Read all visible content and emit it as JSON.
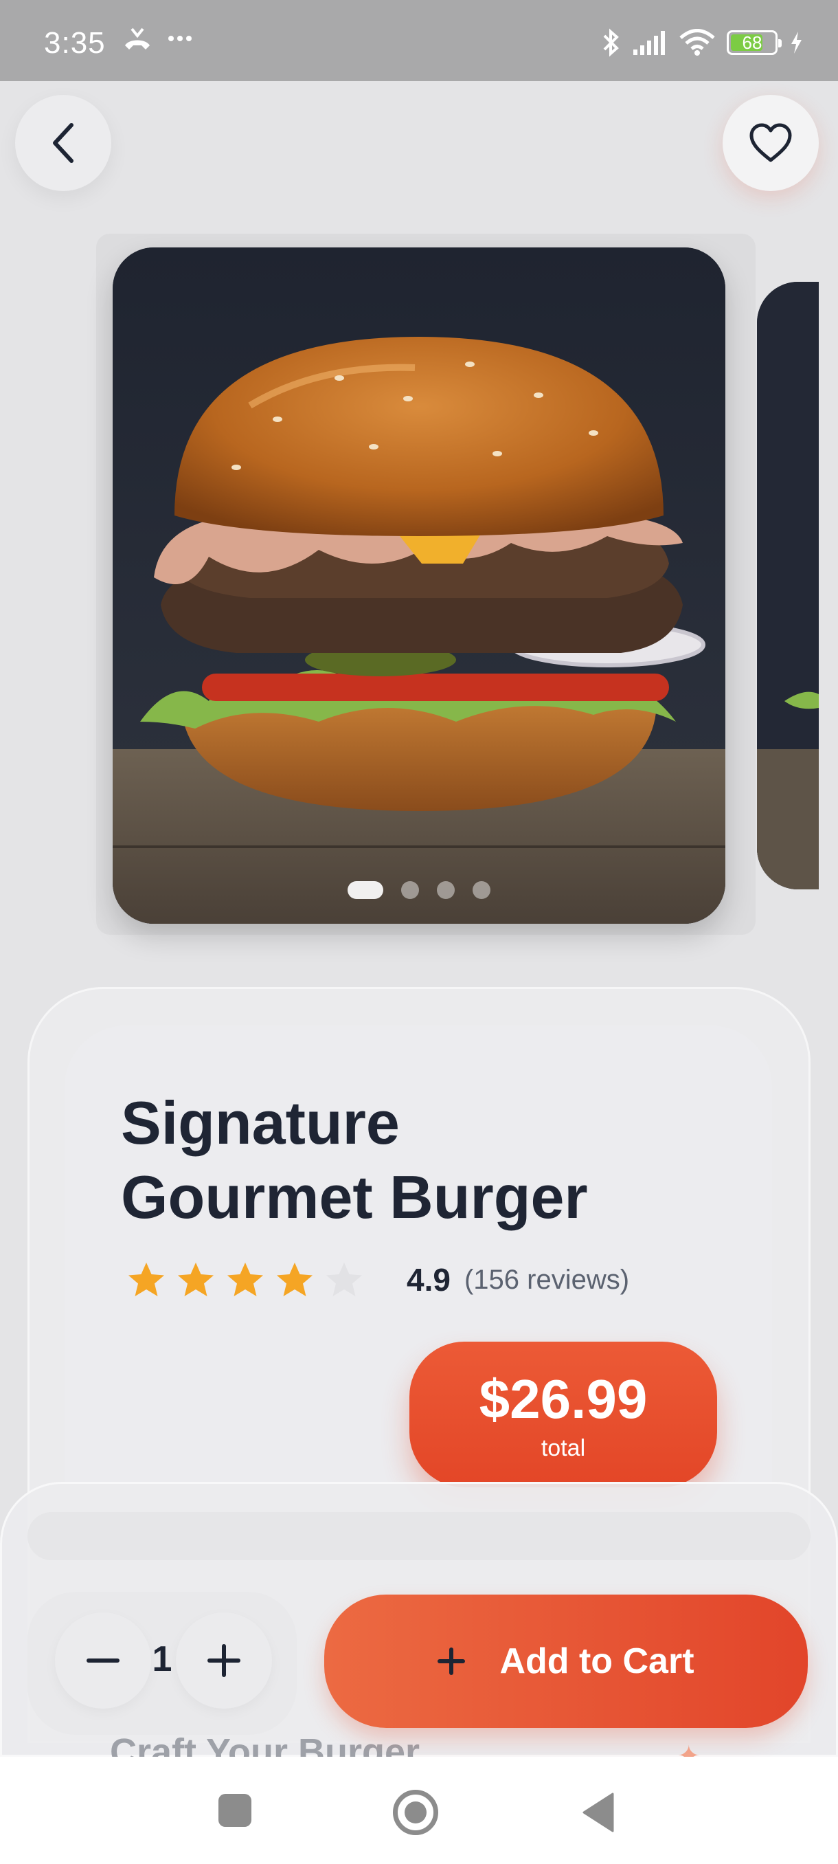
{
  "status_bar": {
    "time": "3:35",
    "battery_level": "68",
    "icons": [
      "missed-call-icon",
      "more-dots-icon",
      "bluetooth-icon",
      "signal-icon",
      "wifi-icon",
      "battery-icon",
      "charging-icon"
    ]
  },
  "header": {
    "back_icon": "chevron-left-icon",
    "favorite_icon": "heart-outline-icon"
  },
  "carousel": {
    "slide_count": 4,
    "active_index": 0
  },
  "product": {
    "title_line1": "Signature",
    "title_line2": "Gourmet Burger",
    "rating": "4.9",
    "reviews": "(156 reviews)",
    "stars_filled": 4,
    "stars_total": 5,
    "price": "$26.99",
    "price_label": "total"
  },
  "customize": {
    "heading": "Craft Your Burger"
  },
  "cart": {
    "quantity": "1",
    "add_label": "Add to Cart"
  },
  "colors": {
    "accent": "#E84B2C",
    "star": "#F5A524",
    "star_empty": "#E2E2E5",
    "text_dark": "#1F2534"
  }
}
